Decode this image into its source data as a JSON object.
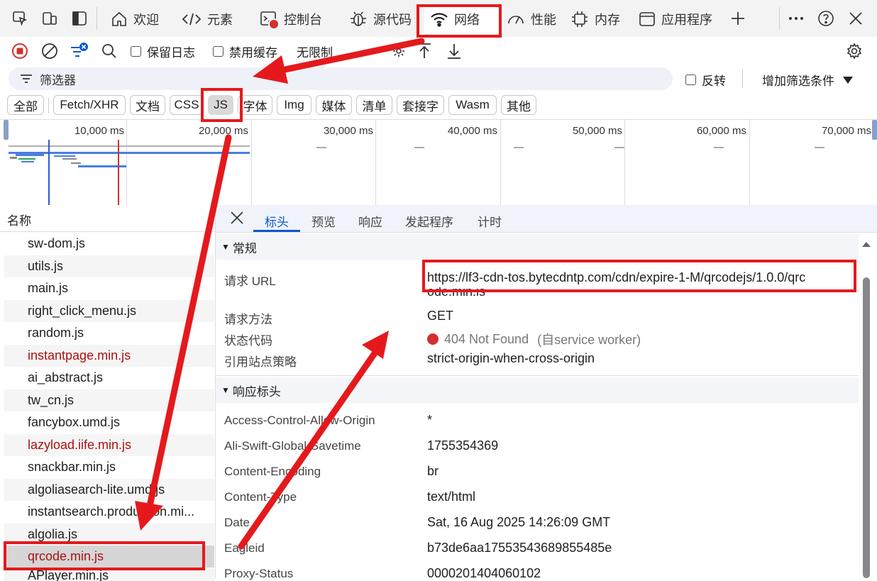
{
  "tabs": [
    {
      "label": "欢迎",
      "icon": "home-icon"
    },
    {
      "label": "元素",
      "icon": "code-icon"
    },
    {
      "label": "控制台",
      "icon": "console-icon"
    },
    {
      "label": "源代码",
      "icon": "bug-icon"
    },
    {
      "label": "网络",
      "icon": "wifi-icon"
    },
    {
      "label": "性能",
      "icon": "gauge-icon"
    },
    {
      "label": "内存",
      "icon": "chip-icon"
    },
    {
      "label": "应用程序",
      "icon": "app-window-icon"
    }
  ],
  "toolbar": {
    "preserve_log": "保留日志",
    "disable_cache": "禁用缓存",
    "throttling": "无限制"
  },
  "filter": {
    "placeholder": "筛选器",
    "invert": "反转",
    "add_filter": "增加筛选条件"
  },
  "chips": [
    "全部",
    "Fetch/XHR",
    "文档",
    "CSS",
    "JS",
    "字体",
    "Img",
    "媒体",
    "清单",
    "套接字",
    "Wasm",
    "其他"
  ],
  "selected_chip": "JS",
  "timeline": {
    "ticks": [
      "10,000 ms",
      "20,000 ms",
      "30,000 ms",
      "40,000 ms",
      "50,000 ms",
      "60,000 ms",
      "70,000 ms"
    ]
  },
  "name_column": {
    "header": "名称",
    "rows": [
      {
        "name": "sw-dom.js",
        "error": false
      },
      {
        "name": "utils.js",
        "error": false
      },
      {
        "name": "main.js",
        "error": false
      },
      {
        "name": "right_click_menu.js",
        "error": false
      },
      {
        "name": "random.js",
        "error": false
      },
      {
        "name": "instantpage.min.js",
        "error": true
      },
      {
        "name": "ai_abstract.js",
        "error": false
      },
      {
        "name": "tw_cn.js",
        "error": false
      },
      {
        "name": "fancybox.umd.js",
        "error": false
      },
      {
        "name": "lazyload.iife.min.js",
        "error": true
      },
      {
        "name": "snackbar.min.js",
        "error": false
      },
      {
        "name": "algoliasearch-lite.umd.js",
        "error": false
      },
      {
        "name": "instantsearch.production.mi...",
        "error": false
      },
      {
        "name": "algolia.js",
        "error": false
      },
      {
        "name": "qrcode.min.js",
        "error": true,
        "selected": true
      },
      {
        "name": "APlayer.min.js",
        "error": false
      }
    ]
  },
  "detail": {
    "tabs": [
      "标头",
      "预览",
      "响应",
      "发起程序",
      "计时"
    ],
    "general": {
      "title": "常规",
      "request_url_key": "请求 URL",
      "request_url_line1": "https://lf3-cdn-tos.bytecdntp.com/cdn/expire-1-M/qrcodejs/1.0.0/qrc",
      "request_url_line2": "ode.min.js",
      "method_key": "请求方法",
      "method": "GET",
      "status_key": "状态代码",
      "status": "404 Not Found",
      "status_note": "(自service worker)",
      "policy_key": "引用站点策略",
      "policy": "strict-origin-when-cross-origin"
    },
    "response_headers": {
      "title": "响应标头",
      "items": [
        {
          "key": "Access-Control-Allow-Origin",
          "value": "*"
        },
        {
          "key": "Ali-Swift-Global-Savetime",
          "value": "1755354369"
        },
        {
          "key": "Content-Encoding",
          "value": "br"
        },
        {
          "key": "Content-Type",
          "value": "text/html"
        },
        {
          "key": "Date",
          "value": "Sat, 16 Aug 2025 14:26:09 GMT"
        },
        {
          "key": "Eagleid",
          "value": "b73de6aa17553543689855485e"
        },
        {
          "key": "Proxy-Status",
          "value": "0000201404060102"
        }
      ]
    }
  },
  "colors": {
    "annotation": "#e5191c",
    "accent": "#0b57d0",
    "error": "#a11111",
    "record": "#d32f2f"
  }
}
